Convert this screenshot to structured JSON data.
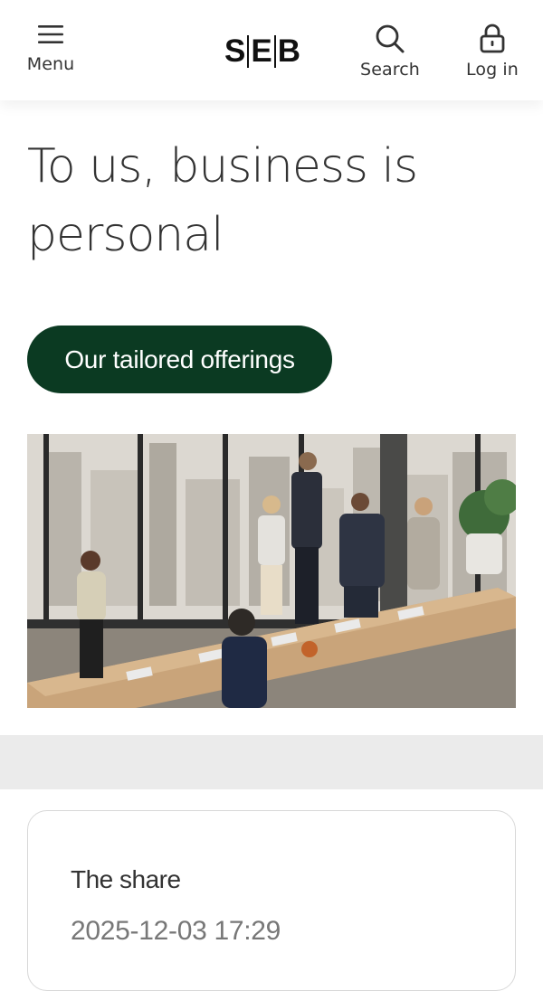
{
  "header": {
    "menu_label": "Menu",
    "logo_text_left": "S",
    "logo_text_mid": "E",
    "logo_text_right": "B",
    "search_label": "Search",
    "login_label": "Log in"
  },
  "hero": {
    "title": "To us, business is personal",
    "cta_label": "Our tailored offerings"
  },
  "share_card": {
    "title": "The share",
    "timestamp": "2025-12-03 17:29"
  },
  "colors": {
    "cta_background": "#0b3a22",
    "band_background": "#ebebeb",
    "text_primary": "#333333",
    "text_muted": "#777777"
  },
  "icons": [
    "menu-icon",
    "search-icon",
    "lock-icon"
  ]
}
